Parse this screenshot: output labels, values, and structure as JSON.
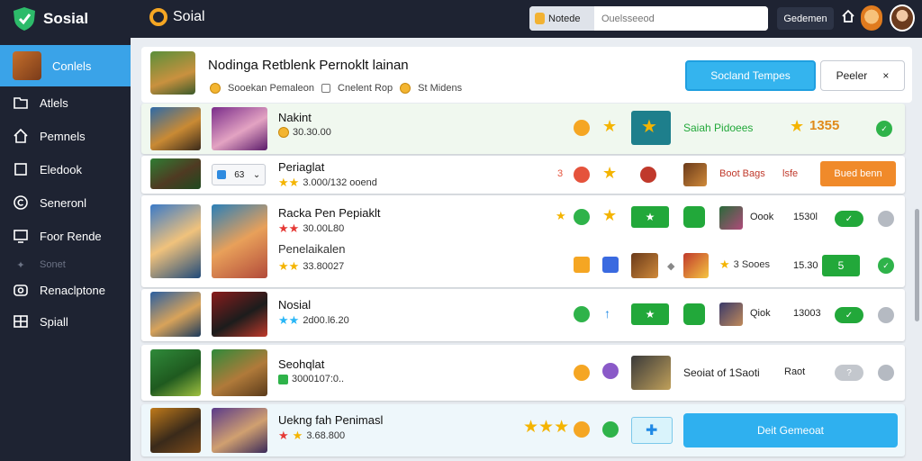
{
  "topbar": {
    "brand": "Sosial",
    "brand2": "Soial",
    "search_prefix": "Notede",
    "search_placeholder": "Ouelsseeod",
    "button": "Gedemen"
  },
  "sidebar": {
    "items": [
      {
        "label": "Conlels",
        "icon": "avatar"
      },
      {
        "label": "Atlels",
        "icon": "folder-icon"
      },
      {
        "label": "Pemnels",
        "icon": "home-icon"
      },
      {
        "label": "Eledook",
        "icon": "square-icon"
      },
      {
        "label": "Seneronl",
        "icon": "copyright-icon"
      },
      {
        "label": "Foor Rende",
        "icon": "display-icon"
      },
      {
        "label": "Sonet",
        "icon": "sparkle-icon"
      },
      {
        "label": "Renaclptone",
        "icon": "camera-icon"
      },
      {
        "label": "Spiall",
        "icon": "grid-icon"
      }
    ]
  },
  "header": {
    "title": "Nodinga Retblenk Pernoklt lainan",
    "meta1": "Sooekan Pemaleon",
    "meta2": "Cnelent Rop",
    "meta3": "St Midens",
    "primary_button": "Socland Tempes",
    "outline_button": "Peeler",
    "close_glyph": "×"
  },
  "rows": [
    {
      "name": "Nakint",
      "rating": "30.30.00",
      "label": "Saiah Pidoees",
      "score": "1355"
    },
    {
      "name": "Periaglat",
      "rating": "3.000/132 ooend",
      "stepper": "63",
      "count": "3",
      "label": "Boot Bags",
      "label2": "lsfe",
      "action": "Bued benn"
    },
    {
      "name": "Racka Pen Pepiaklt",
      "rating": "30.00L80",
      "label": "Oook",
      "value": "1530l"
    },
    {
      "name": "Penelaikalen",
      "rating": "33.80027",
      "label": "3 Sooes",
      "value": "15.30",
      "pill": "5"
    },
    {
      "name": "Nosial",
      "rating": "2d00.l6.20",
      "label": "Qiok",
      "value": "13003"
    },
    {
      "name": "Seohqlat",
      "rating": "3000107:0..",
      "label": "Seoiat of 1Saoti",
      "value": "Raot"
    },
    {
      "name": "Uekng fah Penimasl",
      "rating": "3.68.800",
      "action": "Deit Gemeoat"
    }
  ]
}
